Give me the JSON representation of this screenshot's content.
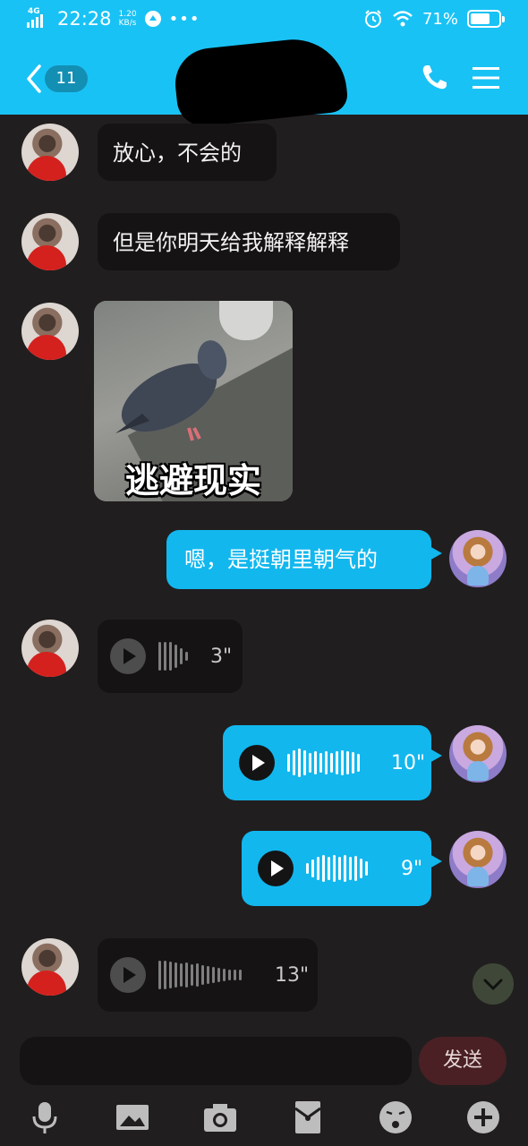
{
  "status_bar": {
    "network": "4G",
    "time": "22:28",
    "speed_value": "1.20",
    "speed_unit": "KB/s",
    "battery": "71%",
    "battery_level": 0.71
  },
  "header": {
    "unread_count": "11"
  },
  "messages": [
    {
      "direction": "in",
      "type": "text",
      "text": "放心，不会的"
    },
    {
      "direction": "in",
      "type": "text",
      "text": "但是你明天给我解释解释"
    },
    {
      "direction": "in",
      "type": "sticker",
      "caption": "逃避现实"
    },
    {
      "direction": "out",
      "type": "text",
      "text": "嗯，是挺朝里朝气的"
    },
    {
      "direction": "in",
      "type": "voice",
      "duration": "3\""
    },
    {
      "direction": "out",
      "type": "voice",
      "duration": "10\""
    },
    {
      "direction": "out",
      "type": "voice",
      "duration": "9\""
    },
    {
      "direction": "in",
      "type": "voice",
      "duration": "13\""
    }
  ],
  "composer": {
    "placeholder": "",
    "send_label": "发送"
  },
  "toolbar": [
    "microphone-icon",
    "image-icon",
    "camera-icon",
    "red-packet-icon",
    "emoji-icon",
    "plus-icon"
  ],
  "colors": {
    "header": "#19c2f5",
    "background": "#211e1f",
    "incoming_bubble": "#151314",
    "outgoing_bubble": "#12b7ee",
    "send_button": "#4a2024"
  }
}
